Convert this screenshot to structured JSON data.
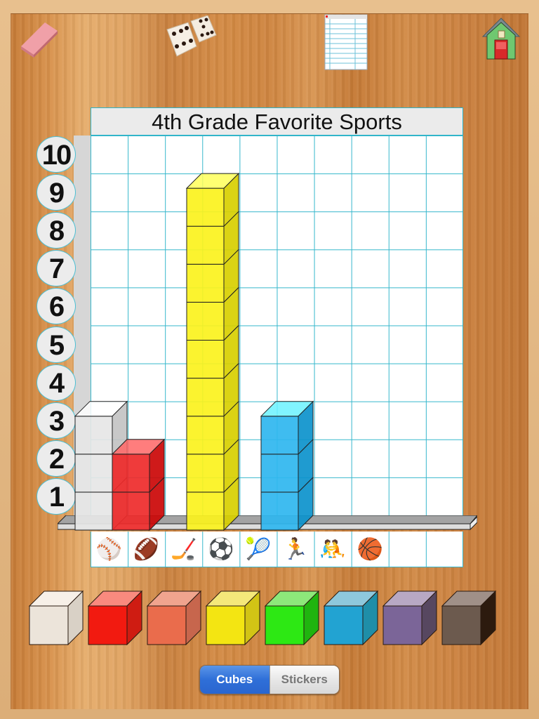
{
  "app": {
    "screen": "Bar graph builder"
  },
  "toolbar": {
    "eraser_icon": "eraser-icon",
    "dice_icon": "dice-icon",
    "notepad_icon": "data-table-icon",
    "home_icon": "home-icon"
  },
  "graph": {
    "title": "4th Grade Favorite Sports",
    "y_labels": [
      "10",
      "9",
      "8",
      "7",
      "6",
      "5",
      "4",
      "3",
      "2",
      "1"
    ],
    "columns": 10
  },
  "chart_data": {
    "type": "bar",
    "title": "4th Grade Favorite Sports",
    "categories": [
      "Baseball",
      "Football",
      "Hockey",
      "Soccer",
      "Tennis",
      "Track",
      "Wrestling",
      "Basketball",
      "",
      ""
    ],
    "category_icons": [
      "baseball-icon",
      "football-icon",
      "hockey-stick-icon",
      "soccer-ball-icon",
      "tennis-racket-icon",
      "runner-icon",
      "wrestlers-icon",
      "basketball-icon",
      "",
      ""
    ],
    "category_glyphs": [
      "⚾",
      "🏈",
      "🏒",
      "⚽",
      "🎾",
      "🏃",
      "🤼",
      "🏀",
      "",
      ""
    ],
    "values": [
      3,
      2,
      0,
      9,
      0,
      3,
      0,
      0,
      0,
      0
    ],
    "bar_colors": [
      "#e6e6e6",
      "#ee2a2a",
      "",
      "#fbf21d",
      "",
      "#2fb6ef",
      "",
      "",
      "",
      ""
    ],
    "ylim": [
      0,
      10
    ],
    "xlabel": "",
    "ylabel": "",
    "grid": true
  },
  "palette": {
    "colors": [
      {
        "name": "white",
        "front": "#ece4da",
        "top": "#f7f0e8",
        "side": "#d9d1c6"
      },
      {
        "name": "red",
        "front": "#f21a10",
        "top": "#f98a7e",
        "side": "#cf1c12"
      },
      {
        "name": "salmon",
        "front": "#ea6c4c",
        "top": "#f0a48e",
        "side": "#c7664d"
      },
      {
        "name": "yellow",
        "front": "#f3e512",
        "top": "#f4e87a",
        "side": "#d2c415"
      },
      {
        "name": "green",
        "front": "#2de814",
        "top": "#8de87a",
        "side": "#20b40f"
      },
      {
        "name": "blue",
        "front": "#22a3d2",
        "top": "#8ec8dc",
        "side": "#1f8ea8"
      },
      {
        "name": "purple",
        "front": "#7b6598",
        "top": "#b8a8c4",
        "side": "#574760"
      },
      {
        "name": "brown",
        "front": "#6c5a4e",
        "top": "#a09088",
        "side": "#2c1a0e"
      }
    ]
  },
  "mode_toggle": {
    "options": [
      "Cubes",
      "Stickers"
    ],
    "selected": "Cubes"
  }
}
